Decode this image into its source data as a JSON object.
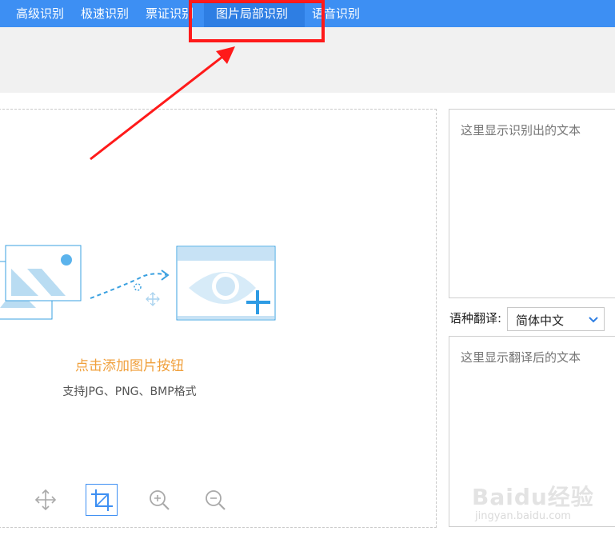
{
  "nav": {
    "tabs": [
      {
        "label": "高级识别",
        "active": false
      },
      {
        "label": "极速识别",
        "active": false
      },
      {
        "label": "票证识别",
        "active": false
      },
      {
        "label": "图片局部识别",
        "active": true
      },
      {
        "label": "语音识别",
        "active": false
      }
    ]
  },
  "upload": {
    "add_hint": "点击添加图片按钮",
    "format_hint": "支持JPG、PNG、BMP格式"
  },
  "toolbar": {
    "icons": [
      "move-icon",
      "crop-icon",
      "zoom-in-icon",
      "zoom-out-icon"
    ],
    "active_tool": "crop-icon"
  },
  "ocr_output": {
    "placeholder": "这里显示识别出的文本"
  },
  "translate": {
    "label": "语种翻译:",
    "selected": "简体中文",
    "placeholder": "这里显示翻译后的文本"
  },
  "watermark": {
    "logo": "Baidu经验",
    "url": "jingyan.baidu.com"
  },
  "colors": {
    "nav_bg": "#3d8ff3",
    "nav_active": "#2e7ee3",
    "accent_orange": "#f0a03c",
    "annotation_red": "#ff1a1a"
  }
}
